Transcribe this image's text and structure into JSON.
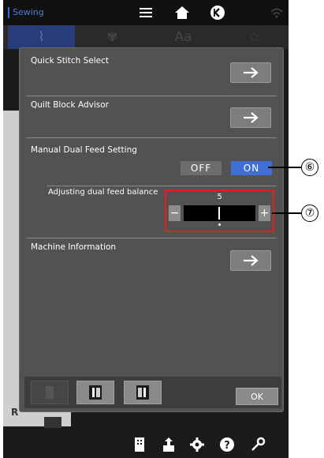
{
  "topbar": {
    "app_label": "Sewing",
    "icons": [
      "menu-icon",
      "home-icon",
      "back-icon",
      "wifi-icon"
    ]
  },
  "tabs": [
    {
      "name": "stitch",
      "glyph": "⌇"
    },
    {
      "name": "embroidery",
      "glyph": "✾"
    },
    {
      "name": "letters",
      "glyph": "Aa"
    },
    {
      "name": "favorites",
      "glyph": "☆"
    }
  ],
  "settings": {
    "quick_stitch_label": "Quick Stitch Select",
    "quilt_block_label": "Quilt Block Advisor",
    "dual_feed_label": "Manual Dual Feed Setting",
    "toggle_off_label": "OFF",
    "toggle_on_label": "ON",
    "toggle_selected": "ON",
    "balance_label": "Adjusting dual feed balance",
    "balance_value": "5",
    "minus_label": "−",
    "plus_label": "+",
    "machine_info_label": "Machine Information"
  },
  "footer": {
    "ok_label": "OK"
  },
  "background": {
    "r_label": "R"
  },
  "callouts": {
    "c6": "⑥",
    "c7": "⑦"
  },
  "colors": {
    "accent": "#3f6fd2",
    "highlight_box": "#e02020",
    "dialog_bg": "#525252"
  }
}
